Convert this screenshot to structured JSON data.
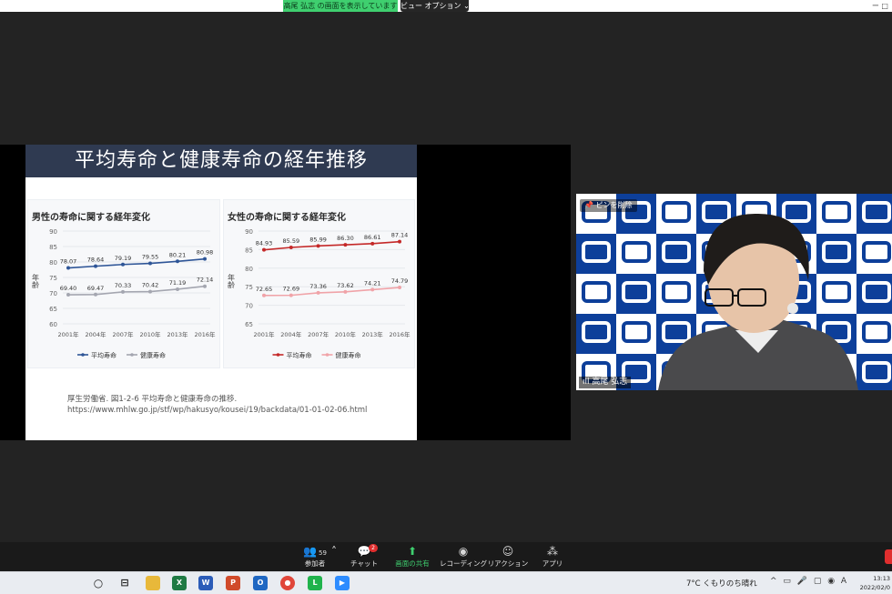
{
  "topbar": {
    "share_indicator": "高尾 弘志 の画面を表示しています",
    "view_options": "ビュー オプション ⌄",
    "window_controls": "ー   □"
  },
  "slide": {
    "title": "平均寿命と健康寿命の経年推移",
    "source_line1": "厚生労働省. 図1-2-6 平均寿命と健康寿命の推移.",
    "source_line2": "https://www.mhlw.go.jp/stf/wp/hakusyo/kousei/19/backdata/01-01-02-06.html"
  },
  "chart_data": [
    {
      "type": "line",
      "title": "男性の寿命に関する経年変化",
      "ylabel": "年齢",
      "x": [
        "2001年",
        "2004年",
        "2007年",
        "2010年",
        "2013年",
        "2016年"
      ],
      "ylim": [
        60,
        90
      ],
      "yticks": [
        60,
        65,
        70,
        75,
        80,
        85,
        90
      ],
      "series": [
        {
          "name": "平均寿命",
          "color": "#2e5597",
          "values": [
            78.07,
            78.64,
            79.19,
            79.55,
            80.21,
            80.98
          ]
        },
        {
          "name": "健康寿命",
          "color": "#a4a6b0",
          "values": [
            69.4,
            69.47,
            70.33,
            70.42,
            71.19,
            72.14
          ]
        }
      ],
      "legend": "bottom"
    },
    {
      "type": "line",
      "title": "女性の寿命に関する経年変化",
      "ylabel": "年齢",
      "x": [
        "2001年",
        "2004年",
        "2007年",
        "2010年",
        "2013年",
        "2016年"
      ],
      "ylim": [
        65,
        90
      ],
      "yticks": [
        65,
        70,
        75,
        80,
        85,
        90
      ],
      "series": [
        {
          "name": "平均寿命",
          "color": "#c42828",
          "values": [
            84.93,
            85.59,
            85.99,
            86.3,
            86.61,
            87.14
          ]
        },
        {
          "name": "健康寿命",
          "color": "#f0a3a8",
          "values": [
            72.65,
            72.69,
            73.36,
            73.62,
            74.21,
            74.79
          ]
        }
      ],
      "legend": "bottom"
    }
  ],
  "video": {
    "pin_label": "ピンを削除",
    "name": "高尾 弘志"
  },
  "toolbar": {
    "participants_label": "参加者",
    "participants_count": "59",
    "chat_label": "チャット",
    "chat_badge": "2",
    "share_label": "画面の共有",
    "record_label": "レコーディング",
    "reactions_label": "リアクション",
    "apps_label": "アプリ"
  },
  "taskbar": {
    "weather": "7°C くもりのち晴れ",
    "tray": "^ ▭ 🎤 ▢ ◉ A",
    "time": "13:13",
    "date": "2022/02/0"
  },
  "colors": {
    "share_green": "#3fcf6f",
    "slide_title_bg": "#2f3a51",
    "zoom_bg": "#232323"
  }
}
